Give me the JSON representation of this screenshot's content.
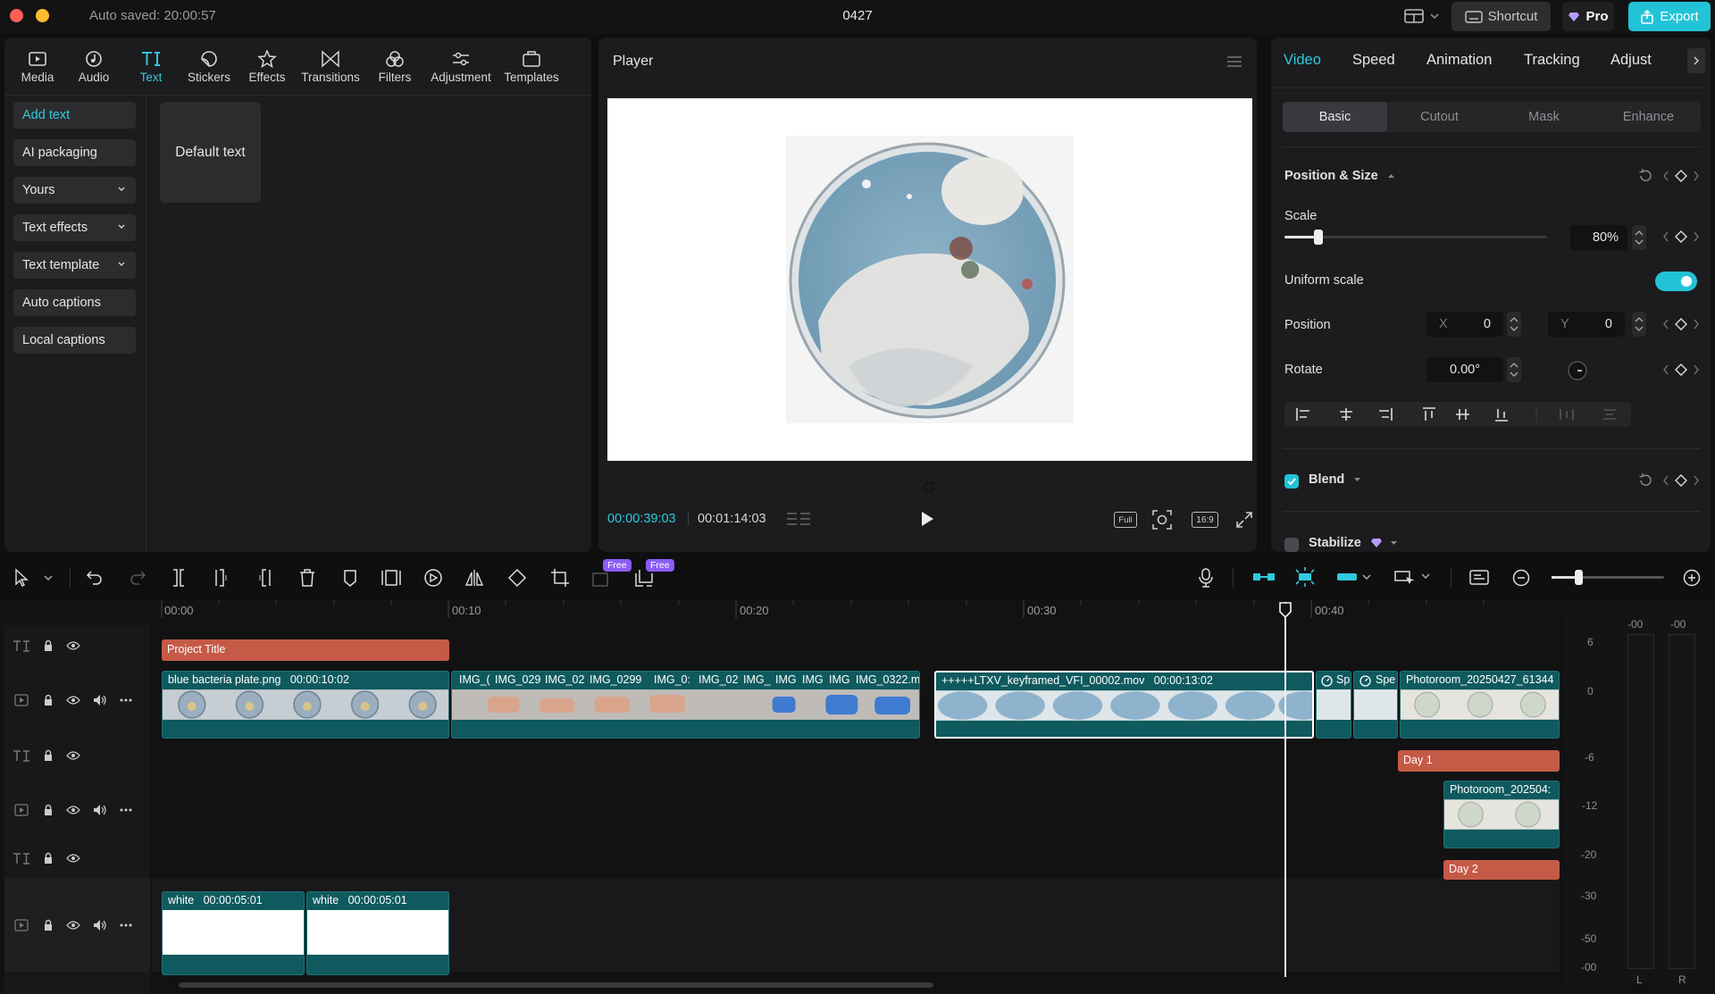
{
  "titlebar": {
    "autosave": "Auto saved: 20:00:57",
    "project_name": "0427",
    "shortcut_label": "Shortcut",
    "pro_label": "Pro",
    "export_label": "Export",
    "accent": "#2fcadb"
  },
  "toolbar": {
    "items": [
      {
        "label": "Media"
      },
      {
        "label": "Audio"
      },
      {
        "label": "Text"
      },
      {
        "label": "Stickers"
      },
      {
        "label": "Effects"
      },
      {
        "label": "Transitions"
      },
      {
        "label": "Filters"
      },
      {
        "label": "Adjustment"
      },
      {
        "label": "Templates"
      }
    ],
    "active": "Text"
  },
  "text_sidebar": {
    "items": [
      {
        "label": "Add text"
      },
      {
        "label": "AI packaging"
      },
      {
        "label": "Yours"
      },
      {
        "label": "Text effects"
      },
      {
        "label": "Text template"
      },
      {
        "label": "Auto captions"
      },
      {
        "label": "Local captions"
      }
    ],
    "default_card": "Default text"
  },
  "player": {
    "title": "Player",
    "current_time": "00:00:39:03",
    "total_time": "00:01:14:03",
    "full_label": "Full",
    "ratio_label": "16:9"
  },
  "inspector": {
    "tabs": [
      {
        "label": "Video"
      },
      {
        "label": "Speed"
      },
      {
        "label": "Animation"
      },
      {
        "label": "Tracking"
      },
      {
        "label": "Adjust"
      }
    ],
    "subtabs": [
      {
        "label": "Basic"
      },
      {
        "label": "Cutout"
      },
      {
        "label": "Mask"
      },
      {
        "label": "Enhance"
      }
    ],
    "section_title": "Position & Size",
    "scale_label": "Scale",
    "scale_value": "80%",
    "scale_level": 0.8,
    "uniform_scale_label": "Uniform scale",
    "uniform_scale_on": true,
    "position_label": "Position",
    "x_label": "X",
    "x_value": "0",
    "y_label": "Y",
    "y_value": "0",
    "rotate_label": "Rotate",
    "rotate_value": "0.00°",
    "blend_label": "Blend",
    "stabilize_label": "Stabilize"
  },
  "timeline_toolbar": {
    "free_badge": "Free"
  },
  "timeline": {
    "ruler": [
      {
        "label": "00:00"
      },
      {
        "label": "00:10"
      },
      {
        "label": "00:20"
      },
      {
        "label": "00:30"
      },
      {
        "label": "00:40"
      }
    ],
    "clips": {
      "project_title": "Project Title",
      "blue_bacteria": "blue bacteria plate.png",
      "blue_bacteria_dur": "00:00:10:02",
      "img_clips": [
        "IMG_(",
        "IMG_029",
        "IMG_02",
        "IMG_0299",
        "IMG_0:",
        "IMG_02",
        "IMG_",
        "IMG",
        "IMG",
        "IMG",
        "IMG_0322.m"
      ],
      "ltxv": "+++++LTXV_keyframed_VFI_00002.mov",
      "ltxv_dur": "00:00:13:02",
      "sp1": "Sp",
      "sp2": "Spe",
      "photoroom_1": "Photoroom_20250427_61344",
      "day1": "Day 1",
      "photoroom_2": "Photoroom_202504:",
      "day2": "Day 2",
      "white_1": "white",
      "white_1_dur": "00:00:05:01",
      "white_2": "white",
      "white_2_dur": "00:00:05:01"
    },
    "meter_scale": [
      "6",
      "0",
      "-6",
      "-12",
      "-20",
      "-30",
      "-50",
      "-00"
    ],
    "meter_top": [
      "-00",
      "-00"
    ],
    "meter_channels": [
      "L",
      "R"
    ]
  }
}
